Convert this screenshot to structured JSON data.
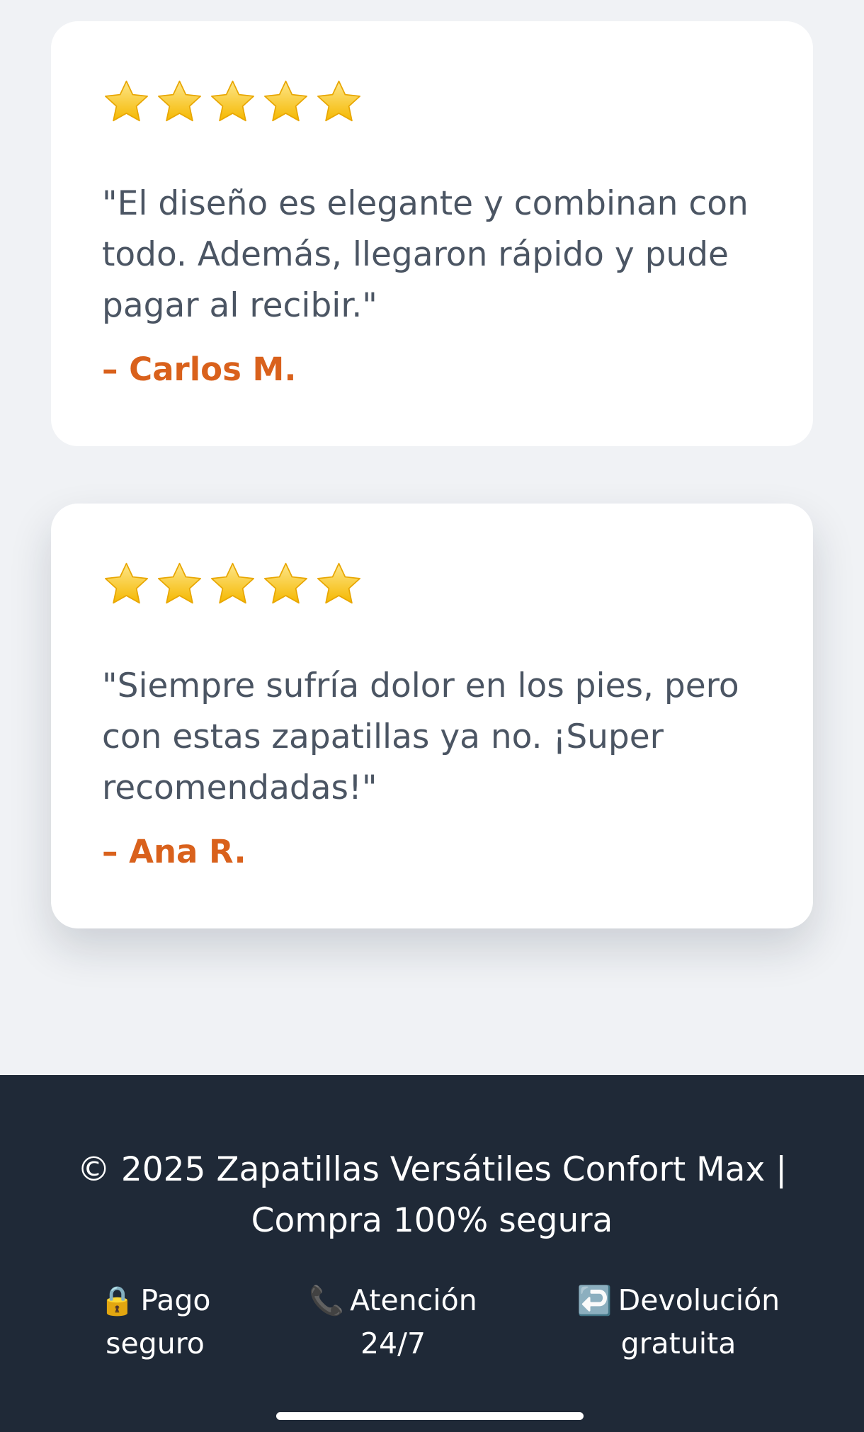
{
  "reviews": [
    {
      "rating": 5,
      "quote": "\"El diseño es elegante y combinan con todo. Además, llegaron rápido y pude pagar al recibir.\"",
      "author": "– Carlos M."
    },
    {
      "rating": 5,
      "quote": "\"Siempre sufría dolor en los pies, pero con estas zapatillas ya no. ¡Super recomendadas!\"",
      "author": "– Ana R."
    }
  ],
  "footer": {
    "copyright": "© 2025 Zapatillas Versátiles Confort Max | Compra 100% segura",
    "features": [
      {
        "icon": "lock-icon",
        "emoji": "🔒",
        "label": "Pago seguro"
      },
      {
        "icon": "phone-icon",
        "emoji": "📞",
        "label": "Atención 24/7"
      },
      {
        "icon": "return-arrow-icon",
        "emoji": "↩️",
        "label": "Devolución gratuita"
      }
    ]
  },
  "colors": {
    "page_background": "#f0f2f5",
    "card_background": "#ffffff",
    "quote_text": "#4b5563",
    "author_accent": "#d9611c",
    "star": "#fcd34d",
    "footer_background": "#1f2937",
    "footer_text": "#ffffff"
  }
}
